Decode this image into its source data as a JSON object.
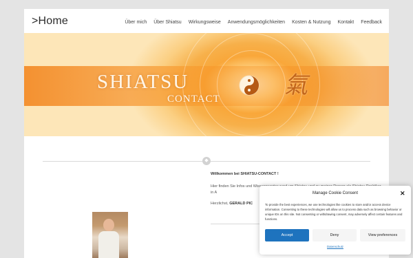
{
  "header": {
    "site_title": ">Home",
    "nav": [
      "Über mich",
      "Über Shiatsu",
      "Wirkungsweise",
      "Anwendungsmöglichkeiten",
      "Kosten & Nutzung",
      "Kontakt",
      "Feedback"
    ]
  },
  "banner": {
    "title": "SHIATSU",
    "subtitle": "CONTACT",
    "kanji": "氣"
  },
  "main": {
    "welcome": "Willkommen bei SHIATSU-CONTACT !",
    "intro": "Hier finden Sie Infos und Wissenswertes rund um Shiatsu und zu meiner Person als Shiatsu-Praktiker in A",
    "greeting_prefix": "Herzlichst,",
    "greeting_name": "GERALD PIC"
  },
  "cookie": {
    "title": "Manage Cookie Consent",
    "text": "To provide the best experiences, we use technologies like cookies to store and/or access device information. Consenting to these technologies will allow us to process data such as browsing behavior or unique IDs on this site. Not consenting or withdrawing consent, may adversely affect certain features and functions.",
    "accept": "Accept",
    "deny": "Deny",
    "preferences": "View preferences",
    "link": "Datenschutz",
    "close": "✕"
  },
  "colors": {
    "accent": "#1e73be",
    "banner_orange": "#f7a030"
  }
}
